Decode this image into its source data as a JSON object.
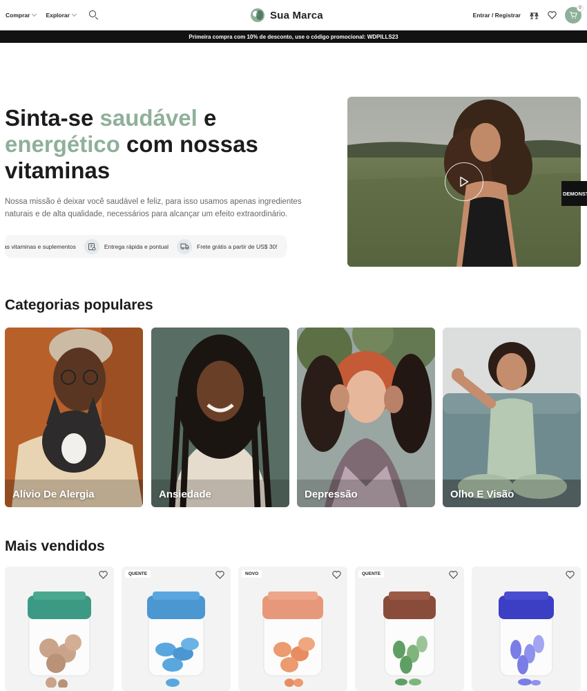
{
  "header": {
    "nav": [
      {
        "label": "Comprar"
      },
      {
        "label": "Explorar"
      }
    ],
    "brand": "Sua Marca",
    "login": "Entrar / Registrar",
    "cart_count": "0"
  },
  "promo": "Primeira compra com 10% de desconto, use o código promocional: WDPILLS23",
  "hero": {
    "title_part1": "Sinta-se ",
    "title_accent1": "saudável",
    "title_part2": " e ",
    "title_accent2": "energético",
    "title_part3": " com nossas vitaminas",
    "description": "Nossa missão é deixar você saudável e feliz, para isso usamos apenas ingredientes naturais e de alta qualidade, necessários para alcançar um efeito extraordinário.",
    "features": [
      {
        "label": "as vitaminas e suplementos"
      },
      {
        "label": "Entrega rápida e pontual",
        "icon": "delivery-box-icon"
      },
      {
        "label": "Frete grátis a partir de US$ 30!",
        "icon": "truck-icon"
      }
    ],
    "demo_tab": "DEMONSTRAÇÃO"
  },
  "categories": {
    "title": "Categorias populares",
    "items": [
      {
        "label": "Alívio De Alergia"
      },
      {
        "label": "Ansiedade"
      },
      {
        "label": "Depressão"
      },
      {
        "label": "Olho E Visão"
      }
    ]
  },
  "bestsellers": {
    "title": "Mais vendidos",
    "products": [
      {
        "badge": "",
        "lid_color": "#3c9a84",
        "pill_color": "#c9a48a"
      },
      {
        "badge": "QUENTE",
        "lid_color": "#4a97d1",
        "pill_color": "#5aa7df"
      },
      {
        "badge": "NOVO",
        "lid_color": "#e8987a",
        "pill_color": "#ec9a6f"
      },
      {
        "badge": "QUENTE",
        "lid_color": "#8a4c3a",
        "pill_color": "#5f9f63"
      },
      {
        "badge": "",
        "lid_color": "#3c3fc4",
        "pill_color": "#7a7de6"
      }
    ]
  },
  "colors": {
    "accent": "#8fb09a",
    "promo_bg": "#121212"
  }
}
